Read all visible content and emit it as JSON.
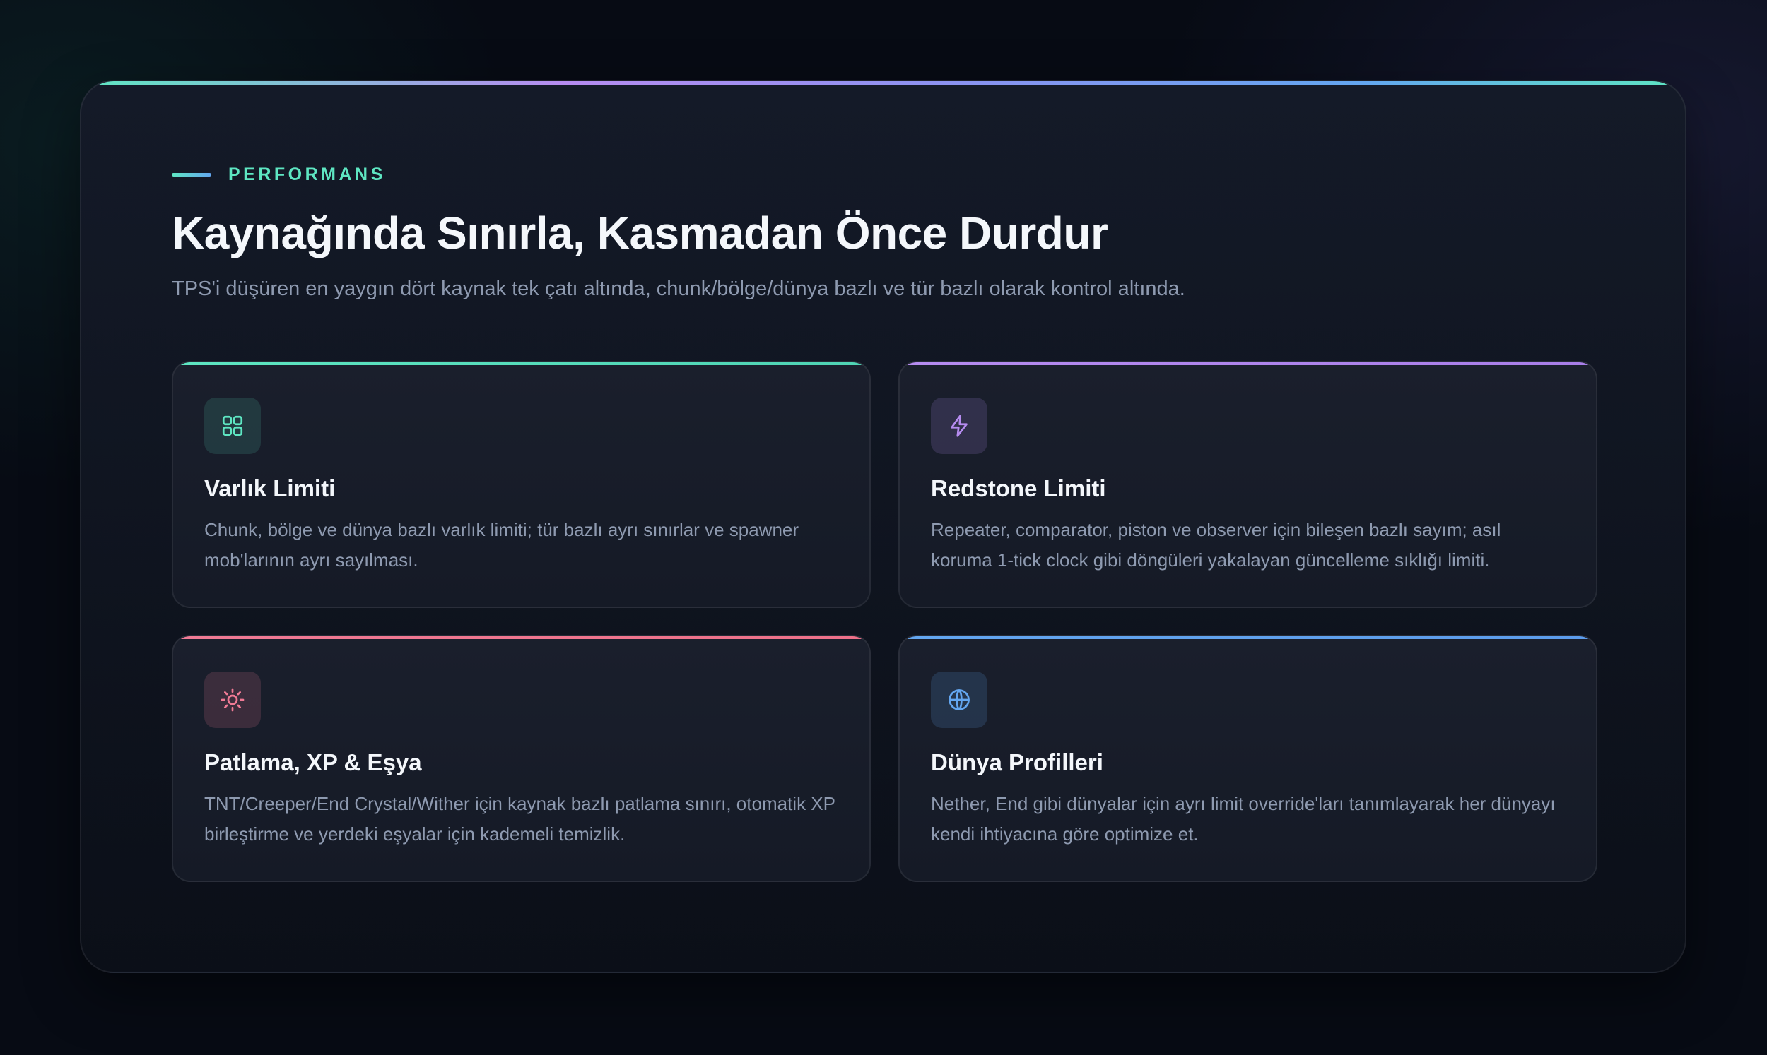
{
  "header": {
    "eyebrow": "PERFORMANS",
    "title": "Kaynağında Sınırla, Kasmadan Önce Durdur",
    "subtitle": "TPS'i düşüren en yaygın dört kaynak tek çatı altında, chunk/bölge/dünya bazlı ve tür bazlı olarak kontrol altında."
  },
  "colors": {
    "accent_teal": "#5ee6c2",
    "accent_purple": "#b68cf0",
    "accent_pink": "#f07a95",
    "accent_blue": "#63a6f0"
  },
  "cards": [
    {
      "icon": "grid-icon",
      "title": "Varlık Limiti",
      "description": "Chunk, bölge ve dünya bazlı varlık limiti; tür bazlı ayrı sınırlar ve spawner mob'larının ayrı sayılması."
    },
    {
      "icon": "lightning-icon",
      "title": "Redstone Limiti",
      "description": "Repeater, comparator, piston ve observer için bileşen bazlı sayım; asıl koruma 1-tick clock gibi döngüleri yakalayan güncelleme sıklığı limiti."
    },
    {
      "icon": "sun-icon",
      "title": "Patlama, XP & Eşya",
      "description": "TNT/Creeper/End Crystal/Wither için kaynak bazlı patlama sınırı, otomatik XP birleştirme ve yerdeki eşyalar için kademeli temizlik."
    },
    {
      "icon": "globe-icon",
      "title": "Dünya Profilleri",
      "description": "Nether, End gibi dünyalar için ayrı limit override'ları tanımlayarak her dünyayı kendi ihtiyacına göre optimize et."
    }
  ]
}
